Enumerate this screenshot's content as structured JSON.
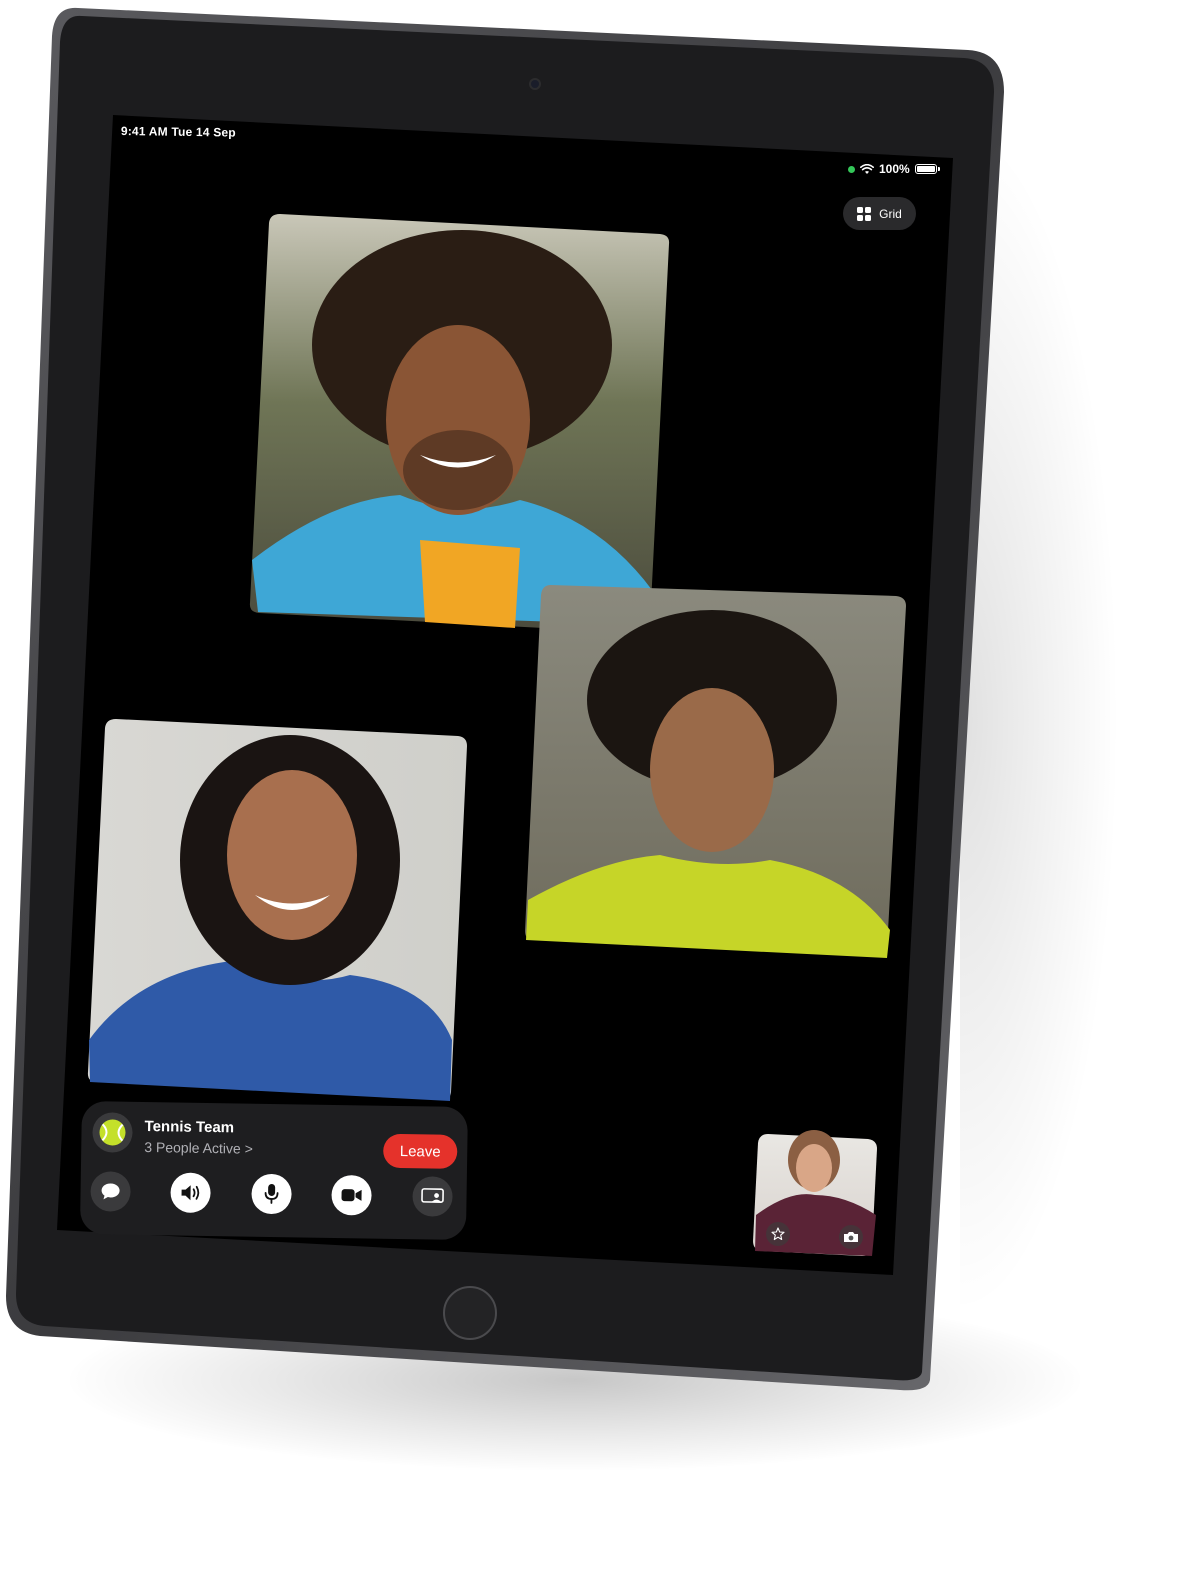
{
  "status_bar": {
    "time_date": "9:41 AM  Tue 14 Sep",
    "battery": "100%"
  },
  "toolbar": {
    "grid_label": "Grid"
  },
  "call": {
    "group_name": "Tennis Team",
    "active_text": "3 People Active >",
    "leave_label": "Leave"
  },
  "icons": {
    "wifi": "wifi-icon",
    "battery": "battery-icon",
    "grid": "grid-icon",
    "messages": "message-bubble-icon",
    "speaker": "speaker-icon",
    "mic": "microphone-icon",
    "video": "video-camera-icon",
    "shareplay": "shareplay-icon",
    "effects": "effects-star-icon",
    "flip": "flip-camera-icon",
    "group_avatar": "tennis-ball-icon"
  },
  "colors": {
    "bezel": "#1c1c1e",
    "screen": "#000000",
    "leave": "#e5322b",
    "recording_dot": "#34c759"
  }
}
